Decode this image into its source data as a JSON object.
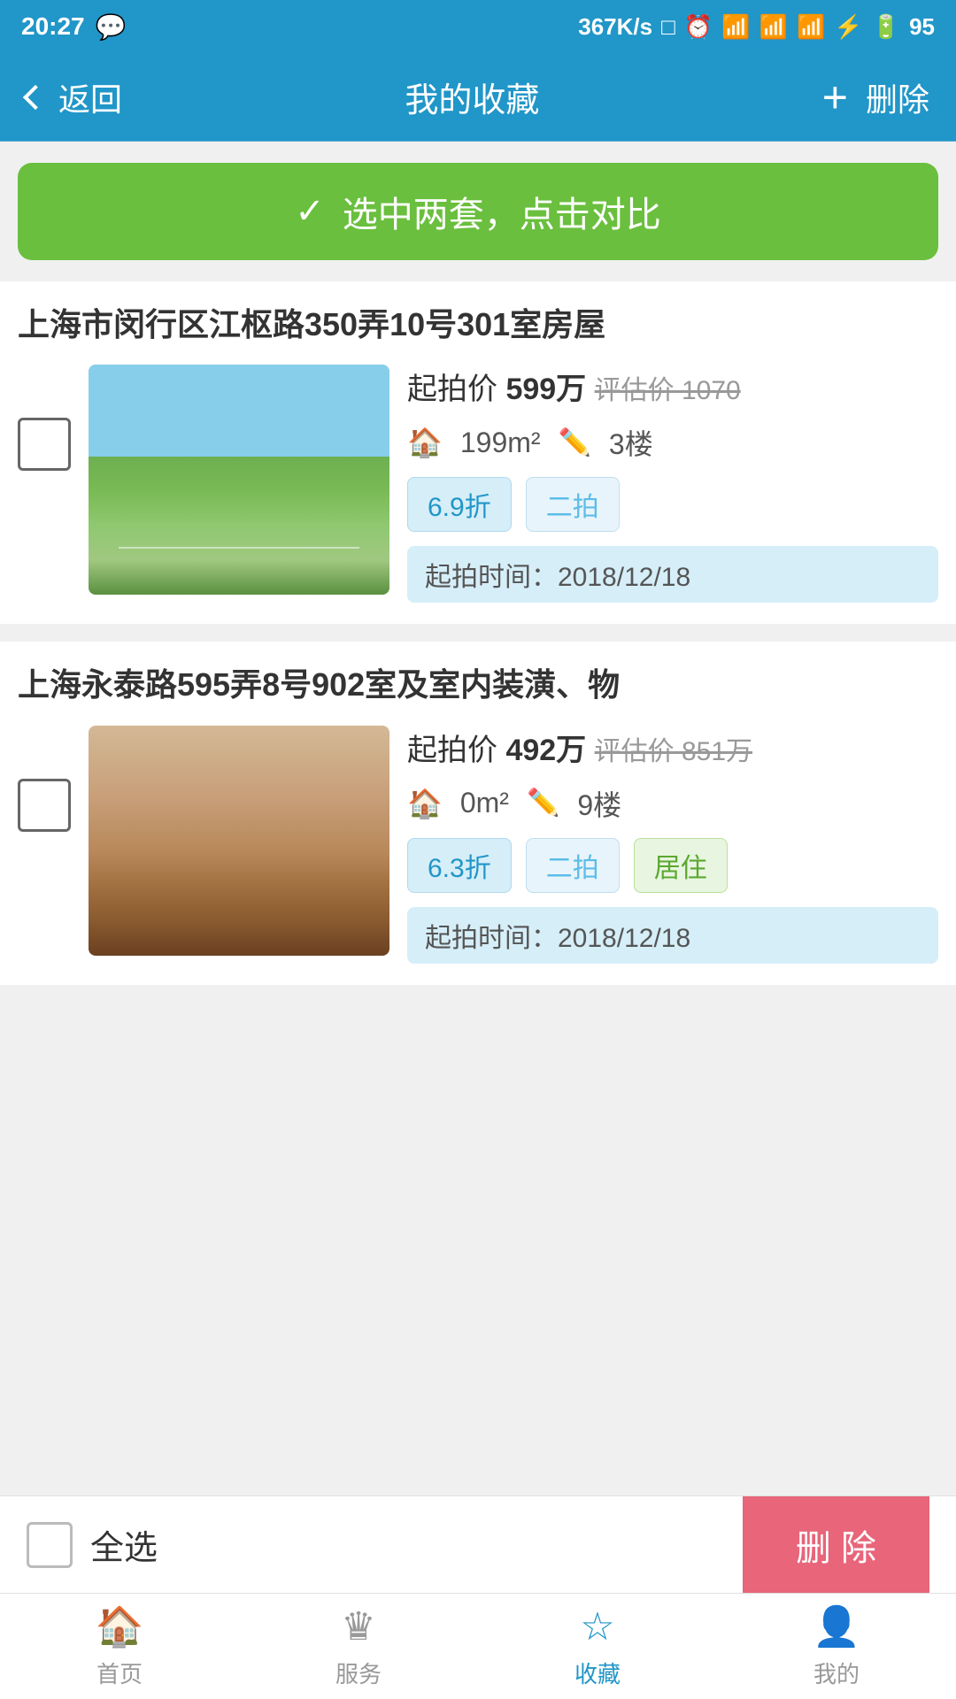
{
  "statusBar": {
    "time": "20:27",
    "networkSpeed": "367K/s",
    "battery": "95"
  },
  "navBar": {
    "backLabel": "返回",
    "title": "我的收藏",
    "addLabel": "+",
    "deleteLabel": "删除"
  },
  "compareBanner": {
    "icon": "✓",
    "text": "选中两套，点击对比"
  },
  "properties": [
    {
      "id": "prop1",
      "title": "上海市闵行区江枢路350弄10号301室房屋",
      "startPrice": "起拍价 599万",
      "estimatedPrice": "评估价 1070",
      "area": "199m²",
      "floor": "3楼",
      "tags": [
        "6.9折",
        "二拍"
      ],
      "auctionTime": "起拍时间：2018/12/18",
      "imageType": "outdoor"
    },
    {
      "id": "prop2",
      "title": "上海永泰路595弄8号902室及室内装潢、物",
      "startPrice": "起拍价 492万",
      "estimatedPrice": "评估价 851万",
      "area": "0m²",
      "floor": "9楼",
      "tags": [
        "6.3折",
        "二拍",
        "居住"
      ],
      "auctionTime": "起拍时间：2018/12/18",
      "imageType": "indoor"
    }
  ],
  "bottomBar": {
    "selectAllLabel": "全选",
    "deleteLabel": "删 除"
  },
  "tabBar": {
    "items": [
      {
        "id": "home",
        "label": "首页",
        "icon": "home"
      },
      {
        "id": "service",
        "label": "服务",
        "icon": "crown"
      },
      {
        "id": "favorites",
        "label": "收藏",
        "icon": "star",
        "active": true
      },
      {
        "id": "mine",
        "label": "我的",
        "icon": "person"
      }
    ]
  }
}
